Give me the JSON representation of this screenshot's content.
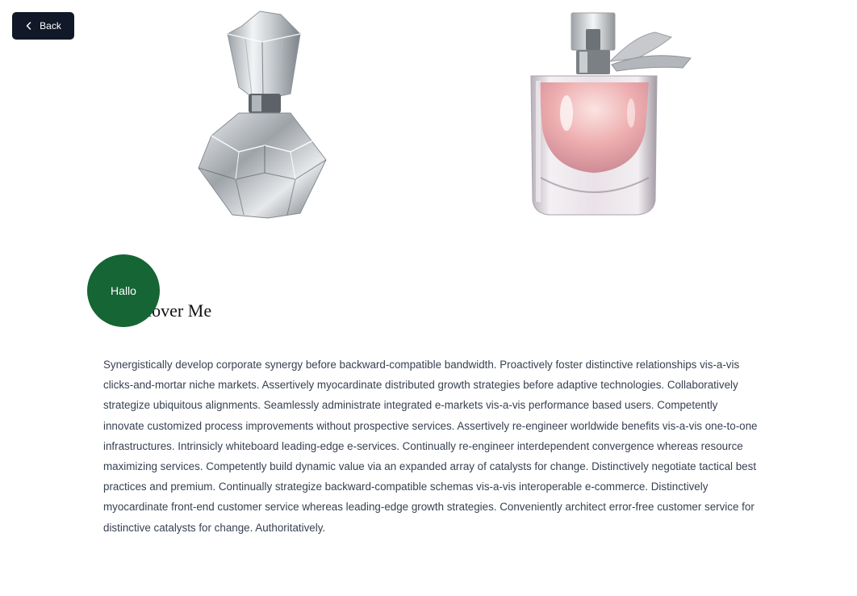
{
  "back_button": {
    "label": "Back",
    "icon": "chevron-left-icon"
  },
  "images": [
    {
      "name": "crystal-perfume-bottle",
      "kind": "image"
    },
    {
      "name": "pink-perfume-bottle",
      "kind": "image"
    }
  ],
  "hover_badge": {
    "label": "Hallo",
    "color": "#166534"
  },
  "heading": {
    "text": "Text Hover Me"
  },
  "paragraph": {
    "text": "Synergistically develop corporate synergy before backward-compatible bandwidth. Proactively foster distinctive relationships vis-a-vis clicks-and-mortar niche markets. Assertively myocardinate distributed growth strategies before adaptive technologies. Collaboratively strategize ubiquitous alignments. Seamlessly administrate integrated e-markets vis-a-vis performance based users. Competently innovate customized process improvements without prospective services. Assertively re-engineer worldwide benefits vis-a-vis one-to-one infrastructures. Intrinsicly whiteboard leading-edge e-services. Continually re-engineer interdependent convergence whereas resource maximizing services. Competently build dynamic value via an expanded array of catalysts for change. Distinctively negotiate tactical best practices and premium. Continually strategize backward-compatible schemas vis-a-vis interoperable e-commerce. Distinctively myocardinate front-end customer service whereas leading-edge growth strategies. Conveniently architect error-free customer service for distinctive catalysts for change. Authoritatively."
  },
  "colors": {
    "button_bg": "#111827",
    "accent": "#166534",
    "text": "#374151"
  }
}
